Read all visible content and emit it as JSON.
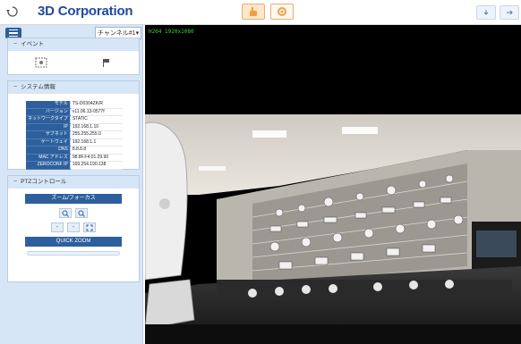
{
  "header": {
    "brand": "3D Corporation"
  },
  "left_panel": {
    "channel_select": "チャンネル#1▾",
    "event_section": {
      "title": "イベント"
    },
    "system_section": {
      "title": "システム情報",
      "rows": [
        {
          "key": "モデル",
          "value": "TS-D0304ZK/R"
        },
        {
          "key": "バージョン",
          "value": "v11.06.13-0577f"
        },
        {
          "key": "ネットワークタイプ",
          "value": "STATIC"
        },
        {
          "key": "IP",
          "value": "192.168.1.10"
        },
        {
          "key": "サブネット",
          "value": "255.255.255.0"
        },
        {
          "key": "ゲートウェイ",
          "value": "192.168.1.1"
        },
        {
          "key": "DNS",
          "value": "8.8.8.8"
        },
        {
          "key": "MAC アドレス",
          "value": "98.8F.F4.01.29.90"
        },
        {
          "key": "ZEROCONF IP",
          "value": "169.254.190.138"
        }
      ]
    },
    "ptz_section": {
      "title": "PTZコントロール",
      "zoom_focus_label": "ズーム/フォーカス",
      "zoom_in_symbol": "🔍",
      "zoom_out_symbol": "🔍",
      "minus1": "-",
      "minus2": "-",
      "quick_zoom": "QUICK ZOOM"
    }
  },
  "video": {
    "stream_label": "H264 1920x1080"
  }
}
